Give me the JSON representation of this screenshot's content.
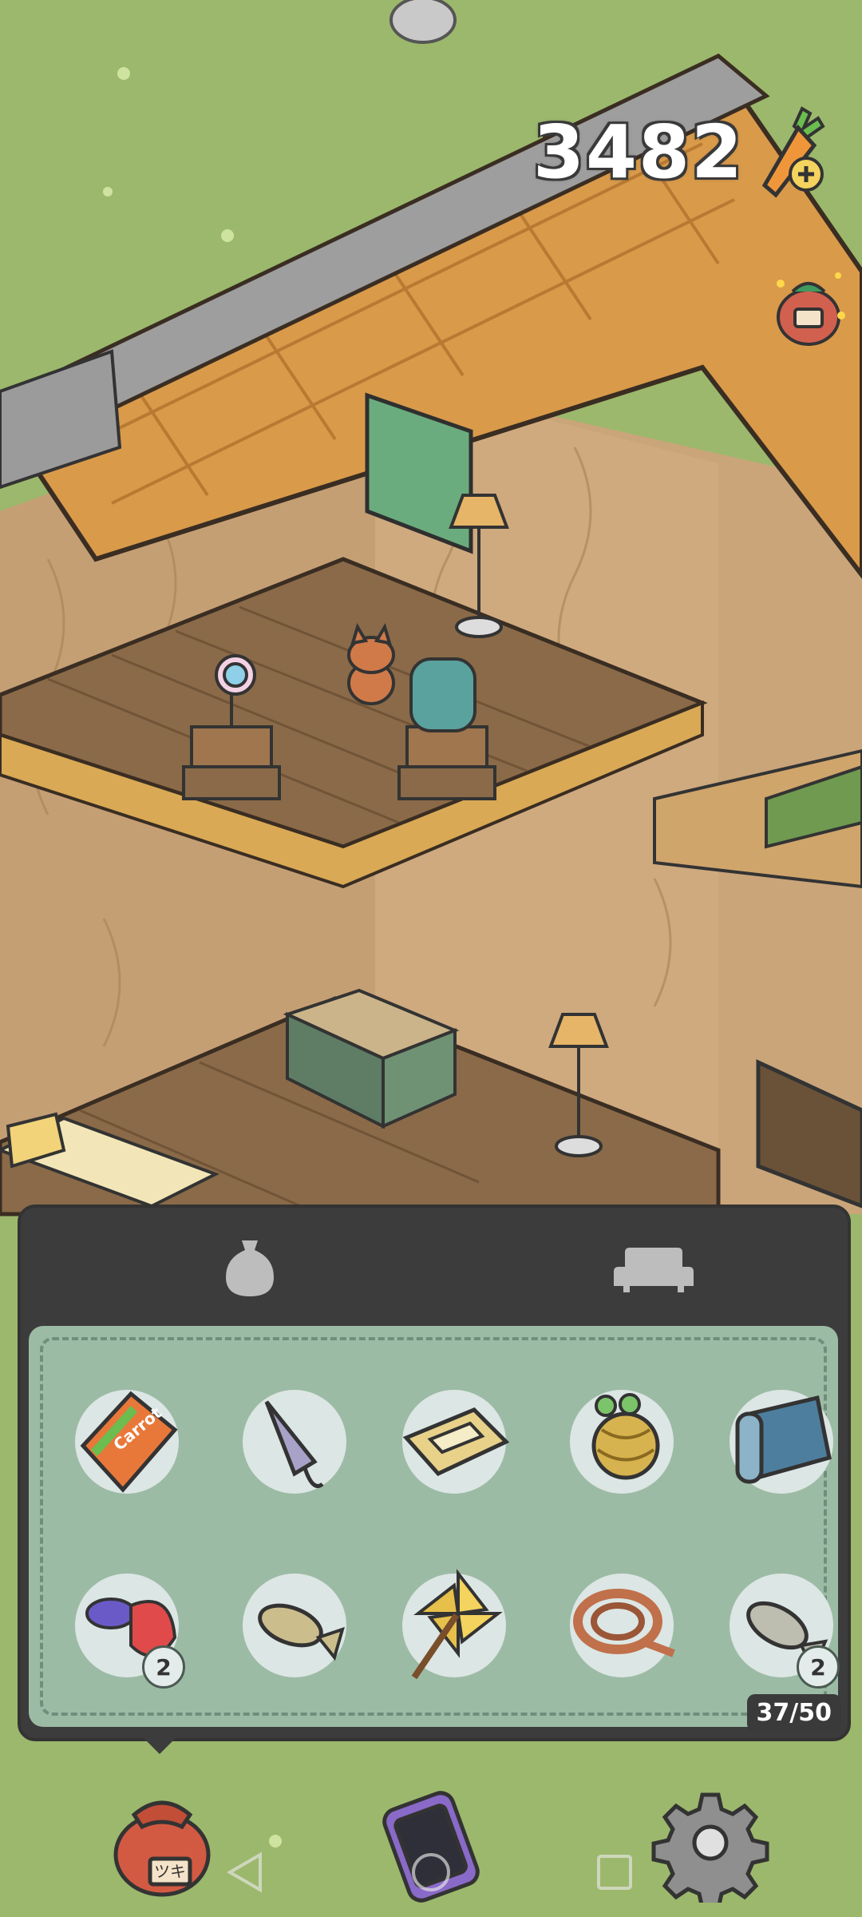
{
  "hud": {
    "currency_value": "3482",
    "currency_icon": "carrot-icon",
    "add_icon": "plus-icon"
  },
  "inventory": {
    "tabs": [
      {
        "icon": "vase-icon",
        "selected": true
      },
      {
        "icon": "sofa-icon",
        "selected": false
      }
    ],
    "capacity": "37/50",
    "items": [
      {
        "icon": "chips-bag-icon",
        "count": ""
      },
      {
        "icon": "umbrella-icon",
        "count": ""
      },
      {
        "icon": "cassette-tape-icon",
        "count": ""
      },
      {
        "icon": "yarn-ball-icon",
        "count": ""
      },
      {
        "icon": "rolled-map-icon",
        "count": ""
      },
      {
        "icon": "betta-fish-icon",
        "count": "2"
      },
      {
        "icon": "fish-icon",
        "count": ""
      },
      {
        "icon": "pinwheel-icon",
        "count": ""
      },
      {
        "icon": "rope-icon",
        "count": ""
      },
      {
        "icon": "fish-icon",
        "count": "2"
      }
    ],
    "chips_bag_label": "Carrot"
  },
  "bottom_bar": {
    "buttons": [
      "sack-icon",
      "phone-icon",
      "gear-icon"
    ],
    "sack_label": "ツキ"
  },
  "system_nav": [
    "back-icon",
    "home-icon",
    "recents-icon"
  ],
  "colors": {
    "grass": "#9cb86c",
    "panel_dark": "#3c3c3c",
    "panel_green": "#9cbba5",
    "roof": "#d99a4a",
    "wood": "#8a6a48"
  }
}
